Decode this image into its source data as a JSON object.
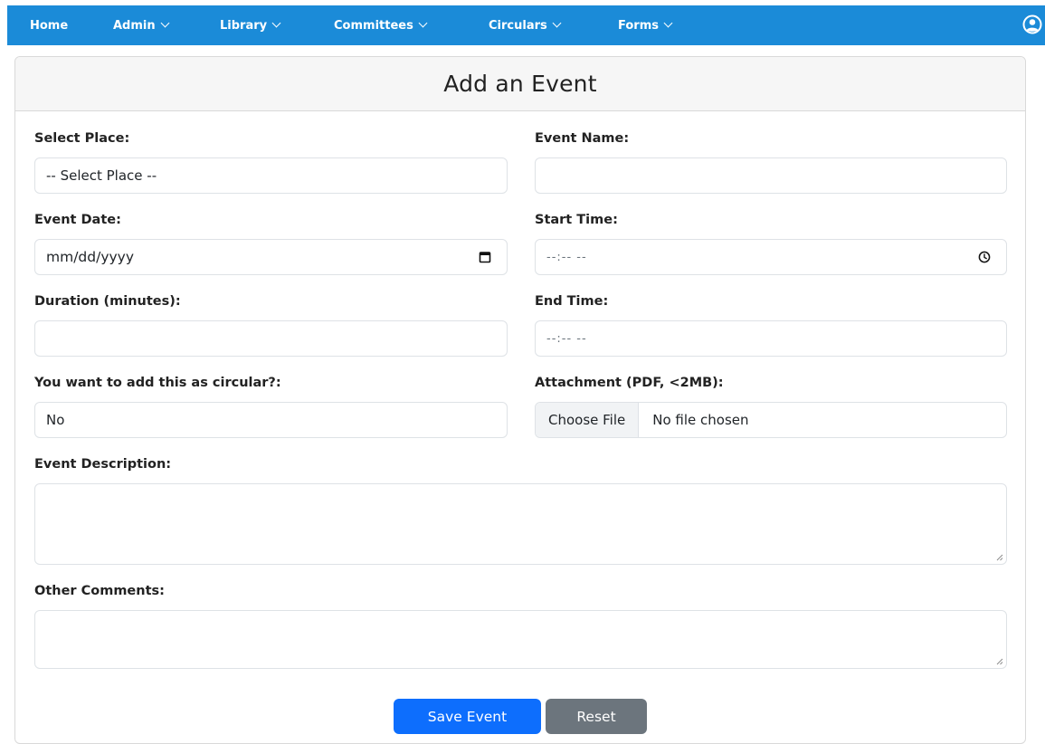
{
  "navbar": {
    "items": [
      {
        "label": "Home",
        "has_dropdown": false
      },
      {
        "label": "Admin",
        "has_dropdown": true
      },
      {
        "label": "Library",
        "has_dropdown": true
      },
      {
        "label": "Committees",
        "has_dropdown": true
      },
      {
        "label": "Circulars",
        "has_dropdown": true
      },
      {
        "label": "Forms",
        "has_dropdown": true
      }
    ],
    "user_icon": "user-circle-icon",
    "background_color": "#1b8bd8"
  },
  "form": {
    "title": "Add an Event",
    "select_place": {
      "label": "Select Place:",
      "value": "-- Select Place --"
    },
    "event_name": {
      "label": "Event Name:",
      "value": ""
    },
    "event_date": {
      "label": "Event Date:",
      "placeholder": "mm/dd/yyyy",
      "icon": "calendar-icon"
    },
    "start_time": {
      "label": "Start Time:",
      "placeholder": "--:-- --",
      "icon": "clock-icon"
    },
    "duration": {
      "label": "Duration (minutes):",
      "value": ""
    },
    "end_time": {
      "label": "End Time:",
      "placeholder": "--:-- --"
    },
    "circular": {
      "label": "You want to add this as circular?:",
      "value": "No"
    },
    "attachment": {
      "label": "Attachment (PDF, <2MB):",
      "button_label": "Choose File",
      "status": "No file chosen"
    },
    "description": {
      "label": "Event Description:",
      "value": ""
    },
    "comments": {
      "label": "Other Comments:",
      "value": ""
    }
  },
  "buttons": {
    "save": {
      "label": "Save Event",
      "color": "#0d6efd"
    },
    "reset": {
      "label": "Reset",
      "color": "#6c757d"
    }
  }
}
